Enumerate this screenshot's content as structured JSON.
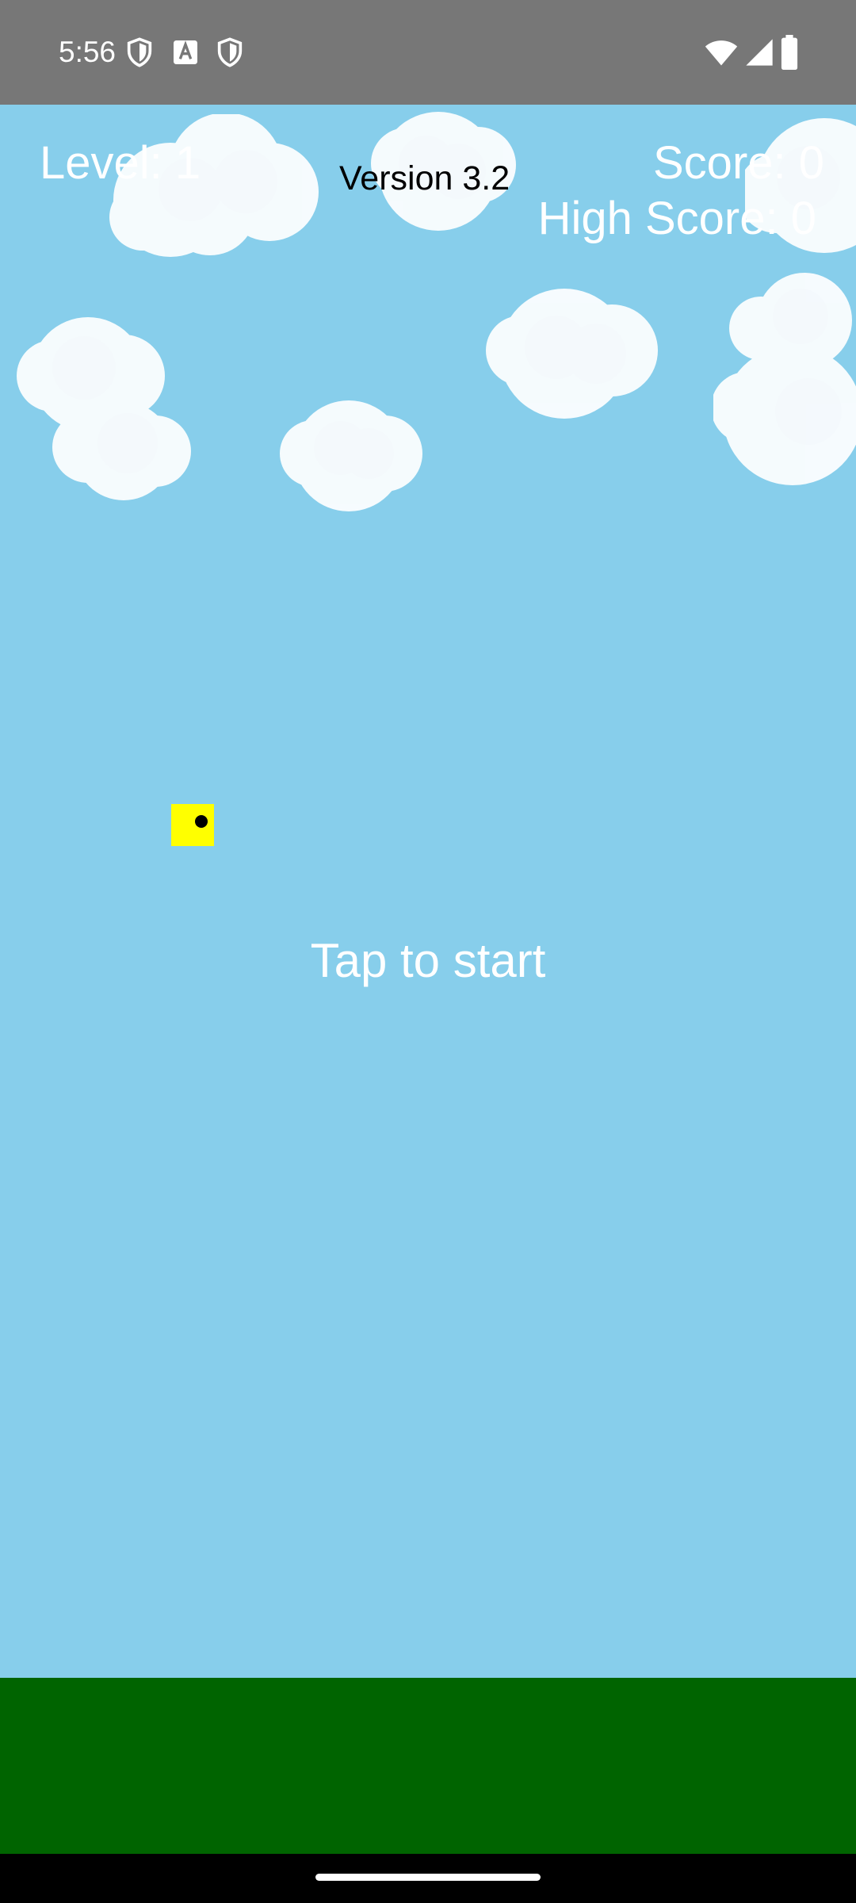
{
  "status_bar": {
    "time": "5:56",
    "left_icons": [
      "shield-icon",
      "font-a-icon",
      "shield-icon"
    ],
    "right_icons": [
      "wifi-icon",
      "cellular-signal-icon",
      "battery-icon"
    ]
  },
  "hud": {
    "level": "Level: 1",
    "version": "Version 3.2",
    "score": "Score: 0",
    "high_score": "High Score: 0"
  },
  "prompt": "Tap to start",
  "colors": {
    "sky": "#87CEEB",
    "ground": "#006400",
    "player": "#FFFF00",
    "status_bar": "#777777"
  }
}
